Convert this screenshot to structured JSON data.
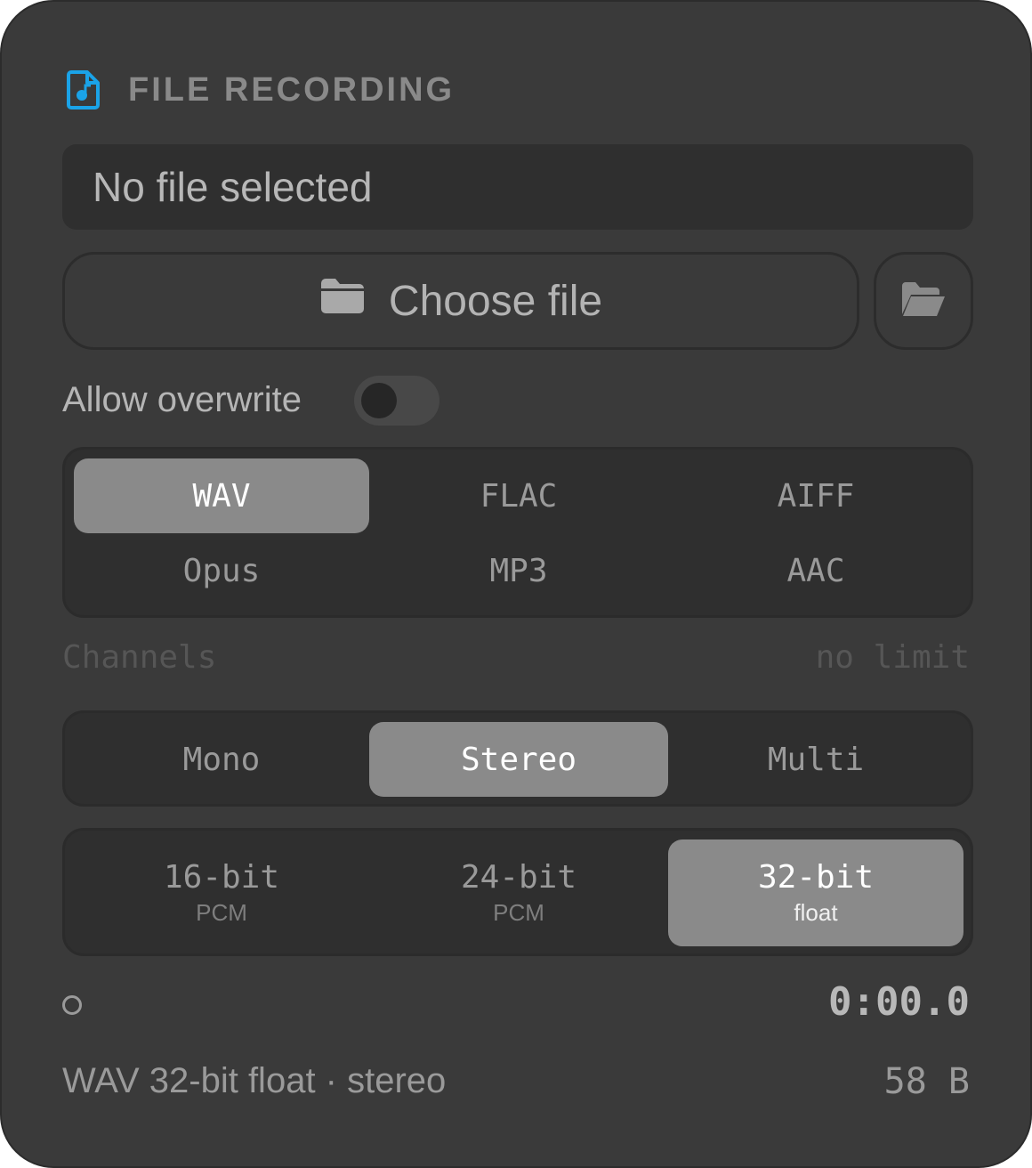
{
  "header": {
    "title": "FILE RECORDING",
    "icon": "file-audio-icon",
    "accent_color": "#1aa3e8"
  },
  "file": {
    "display_text": "No file selected",
    "choose_label": "Choose file",
    "choose_icon": "folder-icon",
    "open_icon": "folder-open-icon"
  },
  "overwrite": {
    "label": "Allow overwrite",
    "enabled": false
  },
  "formats": {
    "options": [
      "WAV",
      "FLAC",
      "AIFF",
      "Opus",
      "MP3",
      "AAC"
    ],
    "selected": "WAV"
  },
  "channels": {
    "label": "Channels",
    "limit_text": "no limit",
    "options": [
      "Mono",
      "Stereo",
      "Multi"
    ],
    "selected": "Stereo"
  },
  "bit_depth": {
    "options": [
      {
        "main": "16-bit",
        "sub": "PCM"
      },
      {
        "main": "24-bit",
        "sub": "PCM"
      },
      {
        "main": "32-bit",
        "sub": "float"
      }
    ],
    "selected": "32-bit"
  },
  "status": {
    "timer": "0:00.0",
    "summary": "WAV 32-bit float · stereo",
    "file_size": "58 B"
  }
}
